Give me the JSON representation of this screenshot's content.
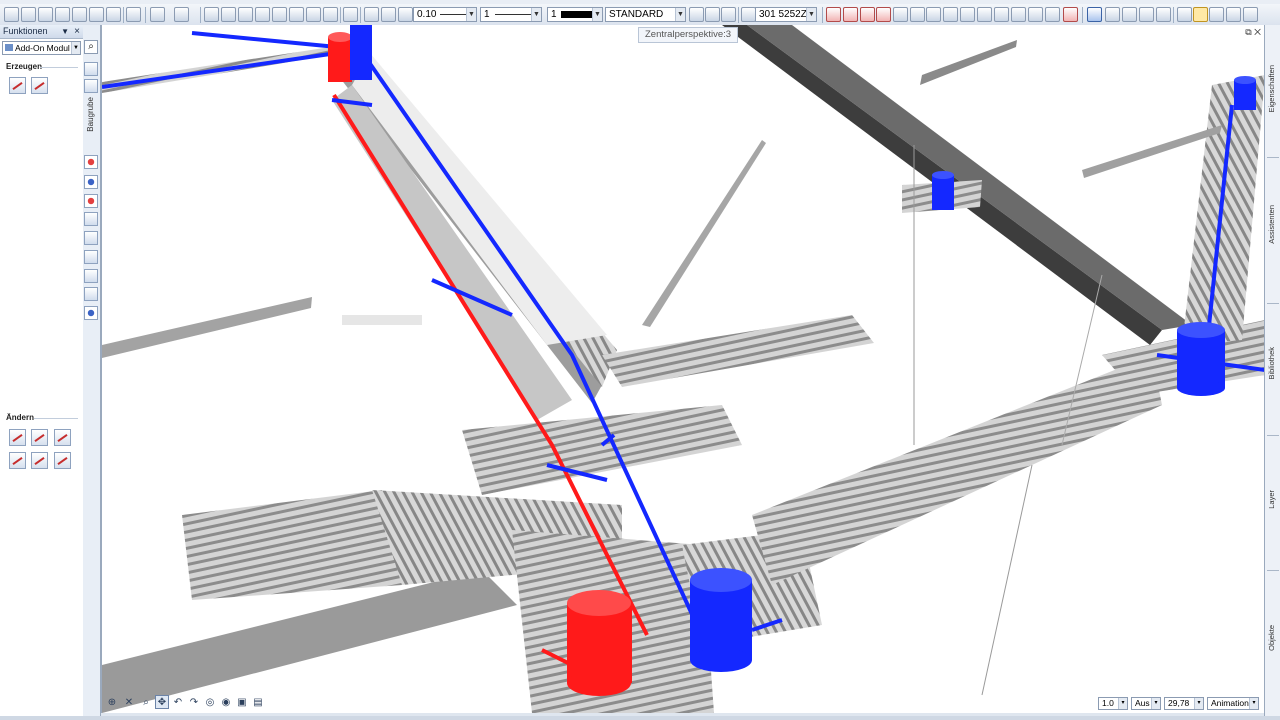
{
  "toolbar": {
    "pen_thickness": "0.10",
    "line_type": "1",
    "color_number": "1",
    "layer": "STANDARD",
    "layer_status": "301 5252Z"
  },
  "left_panel": {
    "title": "Funktionen",
    "close_glyph": "×",
    "pin_glyph": "▼",
    "module_select": "Add-On Modul",
    "search_glyph": "⌕",
    "section_create": "Erzeugen",
    "section_modify": "Ändern",
    "vertical_tab": "Baugrube"
  },
  "viewport": {
    "view_name": "Zentralperspektive:3",
    "window_controls": "⧉ ✕"
  },
  "nav_bar": {
    "icons": [
      "zoom-all-icon",
      "close-view-icon",
      "zoom-window-icon",
      "pan-icon",
      "undo-view-icon",
      "redo-view-icon",
      "camera-icon",
      "eye-icon",
      "fit-icon",
      "dimension-icon"
    ]
  },
  "status_bar": {
    "scale": "1.0",
    "length_unit": "Aus",
    "angle": "29,78",
    "animation_mode": "Animation"
  },
  "right_panel": {
    "tabs": [
      "Eigenschaften",
      "Assistenten",
      "Bibliothek",
      "Layer",
      "Objekte"
    ]
  },
  "colors": {
    "supply_pipe": "#ff1a1a",
    "return_pipe": "#1428ff",
    "terrain": "#8a8a8a",
    "chrome": "#dbe3ee",
    "accent": "#3b63a6"
  }
}
